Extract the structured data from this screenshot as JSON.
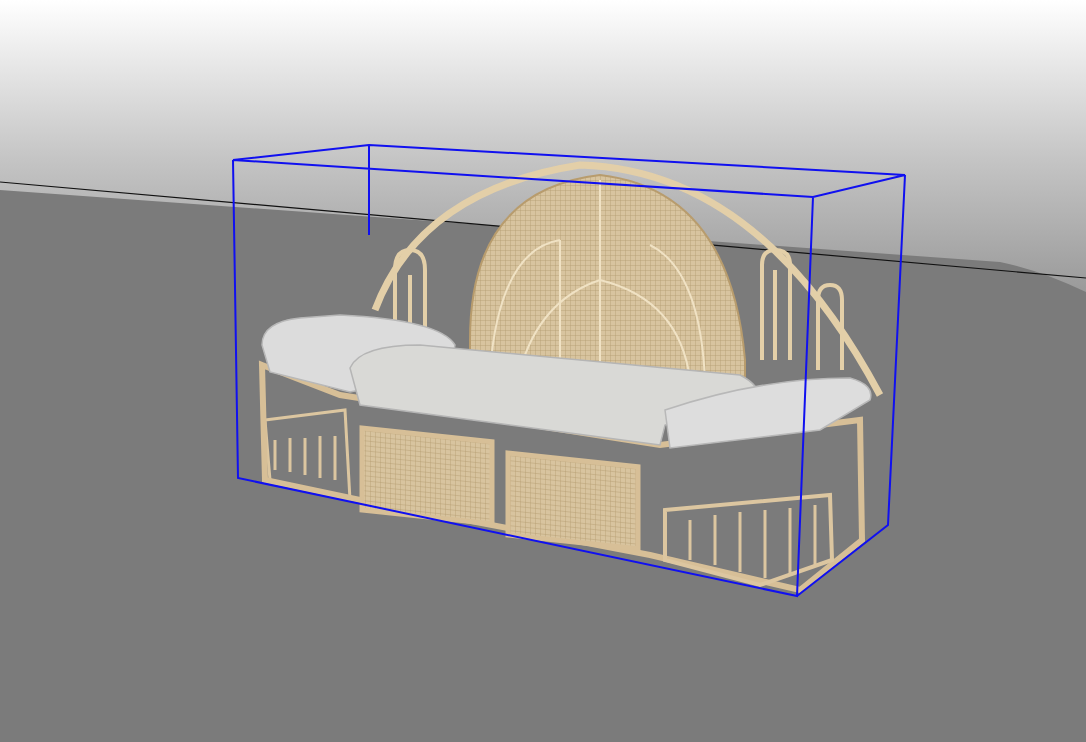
{
  "viewport": {
    "model_selected": true
  }
}
